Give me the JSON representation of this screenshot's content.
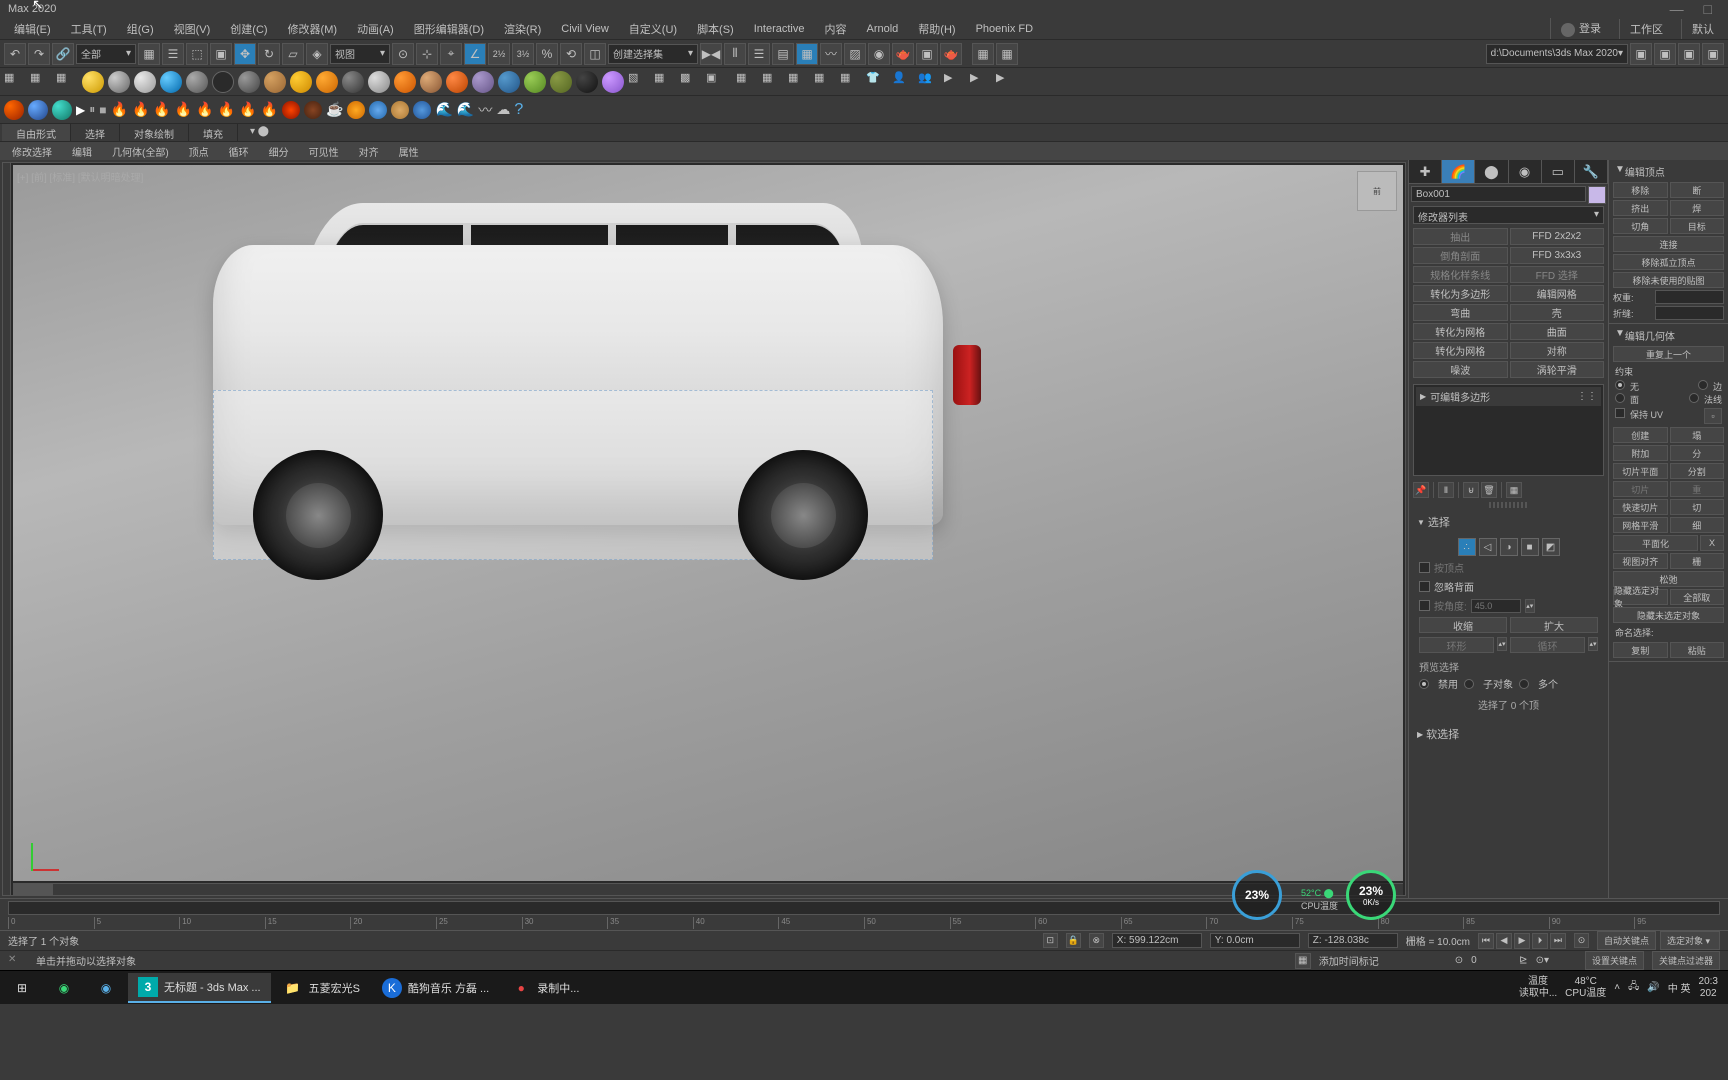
{
  "titlebar": {
    "title": "Max 2020"
  },
  "menubar": {
    "items": [
      "编辑(E)",
      "工具(T)",
      "组(G)",
      "视图(V)",
      "创建(C)",
      "修改器(M)",
      "动画(A)",
      "图形编辑器(D)",
      "渲染(R)",
      "Civil View",
      "自定义(U)",
      "脚本(S)",
      "Interactive",
      "内容",
      "Arnold",
      "帮助(H)",
      "Phoenix FD"
    ],
    "login": "登录",
    "workspace": "工作区",
    "default": "默认"
  },
  "toolbar1": {
    "dropdown_all": "全部",
    "dropdown_view": "视图",
    "dropdown_sel": "创建选择集",
    "project_path": "d:\\Documents\\3ds Max 2020"
  },
  "ribbon": {
    "tabs": [
      "自由形式",
      "选择",
      "对象绘制",
      "填充"
    ],
    "sub": [
      "修改选择",
      "编辑",
      "几何体(全部)",
      "顶点",
      "循环",
      "细分",
      "可见性",
      "对齐",
      "属性"
    ]
  },
  "viewport": {
    "labels": "[+] [前] [标准] [默认明暗处理]",
    "cube": "前"
  },
  "cmd": {
    "obj_name": "Box001",
    "mod_list_label": "修改器列表",
    "modifiers": {
      "r1a": "抽出",
      "r1b": "FFD 2x2x2",
      "r2a": "倒角剖面",
      "r2b": "FFD 3x3x3",
      "r3a": "规格化样条线",
      "r3b": "FFD 选择",
      "r4a": "转化为多边形",
      "r4b": "编辑网格",
      "r5a": "弯曲",
      "r5b": "壳",
      "r6a": "转化为网格",
      "r6b": "曲面",
      "r7a": "转化为网格",
      "r7b": "对称",
      "r8a": "噪波",
      "r8b": "涡轮平滑"
    },
    "stack_item": "可编辑多边形",
    "rollout_select": "选择",
    "by_vertex": "按顶点",
    "ignore_backface": "忽略背面",
    "by_angle": "按角度:",
    "angle_val": "45.0",
    "shrink": "收缩",
    "grow": "扩大",
    "ring": "环形",
    "loop": "循环",
    "preview_sel": "预览选择",
    "disable": "禁用",
    "subobject": "子对象",
    "multiple": "多个",
    "sel_status": "选择了 0 个顶",
    "rollout_soft": "软选择"
  },
  "edit_vertex": {
    "header": "编辑顶点",
    "remove": "移除",
    "break": "断",
    "extrude": "挤出",
    "weld": "焊",
    "chamfer": "切角",
    "target": "目标",
    "connect": "连接",
    "remove_iso": "移除孤立顶点",
    "remove_unused": "移除未使用的贴图",
    "weight": "权重:",
    "crease": "折缝:"
  },
  "edit_geom": {
    "header": "编辑几何体",
    "repeat_last": "重复上一个",
    "constraint": "约束",
    "none": "无",
    "edge": "边",
    "face": "面",
    "normal": "法线",
    "preserve_uv": "保持 UV",
    "create": "创建",
    "collapse": "塌",
    "attach": "附加",
    "detach": "分",
    "slice_plane": "切片平面",
    "split": "分割",
    "slice": "切片",
    "reset": "重",
    "quickslice": "快速切片",
    "cut": "切",
    "msmooth": "网格平滑",
    "tessellate": "细",
    "planarize": "平面化",
    "x_btn": "X",
    "view_align": "视图对齐",
    "grid": "栅",
    "relax": "松弛",
    "hide_sel": "隐藏选定对象",
    "unhide_all": "全部取",
    "hide_unsel": "隐藏未选定对象",
    "named_sel": "命名选择:",
    "copy": "复制",
    "paste": "粘贴"
  },
  "gauges": {
    "g1": "23%",
    "temp_label": "52°C ⬤",
    "cpu_label": "CPU温度",
    "g2": "23%",
    "speed": "0K/s"
  },
  "timeline": {
    "ticks": [
      "0",
      "5",
      "10",
      "15",
      "20",
      "25",
      "30",
      "35",
      "40",
      "45",
      "50",
      "55",
      "60",
      "65",
      "70",
      "75",
      "80",
      "85",
      "90",
      "95"
    ]
  },
  "status": {
    "sel_text": "选择了 1 个对象",
    "hint": "单击并拖动以选择对象",
    "x": "X: 599.122cm",
    "y": "Y: 0.0cm",
    "z": "Z: -128.038c",
    "grid": "栅格 = 10.0cm",
    "frame_spin": "0",
    "auto_key": "自动关键点",
    "sel_obj": "选定对象",
    "set_key": "设置关键点",
    "key_filter": "关键点过滤器",
    "add_time": "添加时间标记"
  },
  "taskbar": {
    "items": [
      {
        "icon": "⊞",
        "label": ""
      },
      {
        "icon": "🟢",
        "label": ""
      },
      {
        "icon": "🔵",
        "label": ""
      },
      {
        "icon": "3",
        "label": "无标题 - 3ds Max ..."
      },
      {
        "icon": "📁",
        "label": "五菱宏光S"
      },
      {
        "icon": "K",
        "label": "酷狗音乐 方磊 ..."
      },
      {
        "icon": "●",
        "label": "录制中..."
      }
    ],
    "tray": {
      "temp1": "温度",
      "reading": "读取中...",
      "temp_val": "48°C",
      "cpu_temp": "CPU温度",
      "ime": "中 英",
      "time": "20:3",
      "date": "202"
    }
  }
}
